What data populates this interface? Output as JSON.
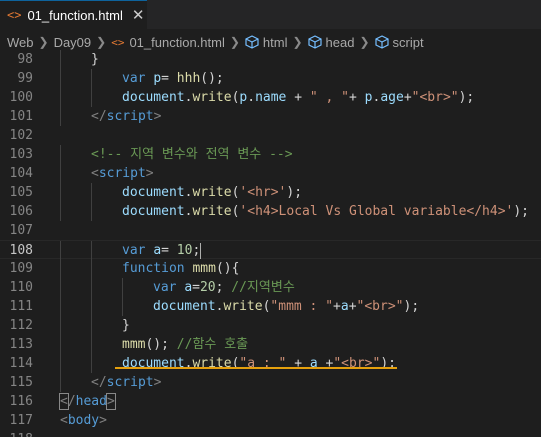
{
  "tab": {
    "icon": "<>",
    "title": "01_function.html",
    "close": "✕"
  },
  "breadcrumb": {
    "items": [
      "Web",
      "Day09",
      "01_function.html",
      "html",
      "head",
      "script"
    ],
    "file_icon": "<>"
  },
  "lines": [
    {
      "n": "98",
      "indent": 1,
      "tokens": [
        [
          "p",
          "}"
        ]
      ]
    },
    {
      "n": "99",
      "indent": 2,
      "tokens": [
        [
          "kw",
          "var"
        ],
        [
          "p",
          " "
        ],
        [
          "var",
          "p"
        ],
        [
          "p",
          "= "
        ],
        [
          "fn",
          "hhh"
        ],
        [
          "p",
          "();"
        ]
      ]
    },
    {
      "n": "100",
      "indent": 2,
      "tokens": [
        [
          "var",
          "document"
        ],
        [
          "p",
          "."
        ],
        [
          "fn",
          "write"
        ],
        [
          "p",
          "("
        ],
        [
          "var",
          "p"
        ],
        [
          "p",
          "."
        ],
        [
          "var",
          "name"
        ],
        [
          "p",
          " + "
        ],
        [
          "str",
          "\" , \""
        ],
        [
          "p",
          "+ "
        ],
        [
          "var",
          "p"
        ],
        [
          "p",
          "."
        ],
        [
          "var",
          "age"
        ],
        [
          "p",
          "+"
        ],
        [
          "str",
          "\"<br>\""
        ],
        [
          "p",
          ");"
        ]
      ]
    },
    {
      "n": "101",
      "indent": 1,
      "tokens": [
        [
          "br",
          "</"
        ],
        [
          "tag",
          "script"
        ],
        [
          "br",
          ">"
        ]
      ]
    },
    {
      "n": "102",
      "indent": 0,
      "tokens": []
    },
    {
      "n": "103",
      "indent": 1,
      "tokens": [
        [
          "com",
          "<!-- 지역 변수와 전역 변수 -->"
        ]
      ]
    },
    {
      "n": "104",
      "indent": 1,
      "tokens": [
        [
          "br",
          "<"
        ],
        [
          "tag",
          "script"
        ],
        [
          "br",
          ">"
        ]
      ]
    },
    {
      "n": "105",
      "indent": 2,
      "tokens": [
        [
          "var",
          "document"
        ],
        [
          "p",
          "."
        ],
        [
          "fn",
          "write"
        ],
        [
          "p",
          "("
        ],
        [
          "str",
          "'<hr>'"
        ],
        [
          "p",
          ");"
        ]
      ]
    },
    {
      "n": "106",
      "indent": 2,
      "tokens": [
        [
          "var",
          "document"
        ],
        [
          "p",
          "."
        ],
        [
          "fn",
          "write"
        ],
        [
          "p",
          "("
        ],
        [
          "str",
          "'<h4>Local Vs Global variable</h4>'"
        ],
        [
          "p",
          ");"
        ]
      ]
    },
    {
      "n": "107",
      "indent": 0,
      "tokens": []
    },
    {
      "n": "108",
      "indent": 2,
      "cursor": true,
      "tokens": [
        [
          "kw",
          "var"
        ],
        [
          "p",
          " "
        ],
        [
          "var",
          "a"
        ],
        [
          "p",
          "= "
        ],
        [
          "num",
          "10"
        ],
        [
          "p",
          ";"
        ]
      ]
    },
    {
      "n": "109",
      "indent": 2,
      "tokens": [
        [
          "kw",
          "function"
        ],
        [
          "p",
          " "
        ],
        [
          "fn",
          "mmm"
        ],
        [
          "p",
          "(){"
        ]
      ]
    },
    {
      "n": "110",
      "indent": 3,
      "tokens": [
        [
          "kw",
          "var"
        ],
        [
          "p",
          " "
        ],
        [
          "var",
          "a"
        ],
        [
          "p",
          "="
        ],
        [
          "num",
          "20"
        ],
        [
          "p",
          "; "
        ],
        [
          "com",
          "//지역변수"
        ]
      ]
    },
    {
      "n": "111",
      "indent": 3,
      "tokens": [
        [
          "var",
          "document"
        ],
        [
          "p",
          "."
        ],
        [
          "fn",
          "write"
        ],
        [
          "p",
          "("
        ],
        [
          "str",
          "\"mmm : \""
        ],
        [
          "p",
          "+"
        ],
        [
          "var",
          "a"
        ],
        [
          "p",
          "+"
        ],
        [
          "str",
          "\"<br>\""
        ],
        [
          "p",
          ");"
        ]
      ]
    },
    {
      "n": "112",
      "indent": 2,
      "tokens": [
        [
          "p",
          "}"
        ]
      ]
    },
    {
      "n": "113",
      "indent": 2,
      "tokens": [
        [
          "fn",
          "mmm"
        ],
        [
          "p",
          "(); "
        ],
        [
          "com",
          "//함수 호출"
        ]
      ]
    },
    {
      "n": "114",
      "indent": 2,
      "tokens": [
        [
          "var",
          "document"
        ],
        [
          "p",
          "."
        ],
        [
          "fn",
          "write"
        ],
        [
          "p",
          "("
        ],
        [
          "str",
          "\"a : \""
        ],
        [
          "p",
          " + "
        ],
        [
          "var",
          "a"
        ],
        [
          "p",
          " +"
        ],
        [
          "str",
          "\"<br>\""
        ],
        [
          "p",
          ");"
        ]
      ]
    },
    {
      "n": "115",
      "indent": 1,
      "tokens": [
        [
          "br",
          "</"
        ],
        [
          "tag",
          "script"
        ],
        [
          "br",
          ">"
        ]
      ]
    },
    {
      "n": "116",
      "indent": 0,
      "tokens": [
        [
          "hl",
          "<"
        ],
        [
          "br",
          "/"
        ],
        [
          "tag",
          "head"
        ],
        [
          "hl",
          ">"
        ]
      ]
    },
    {
      "n": "117",
      "indent": 0,
      "tokens": [
        [
          "br",
          "<"
        ],
        [
          "tag",
          "body"
        ],
        [
          "br",
          ">"
        ]
      ]
    },
    {
      "n": "118",
      "indent": 0,
      "tokens": []
    }
  ],
  "colors": {
    "background": "#1e1e1e",
    "keyword": "#569cd6",
    "variable": "#9cdcfe",
    "function": "#dcdcaa",
    "string": "#ce9178",
    "number": "#b5cea8",
    "comment": "#6a9955",
    "warning_squiggle": "#e5a00d"
  }
}
